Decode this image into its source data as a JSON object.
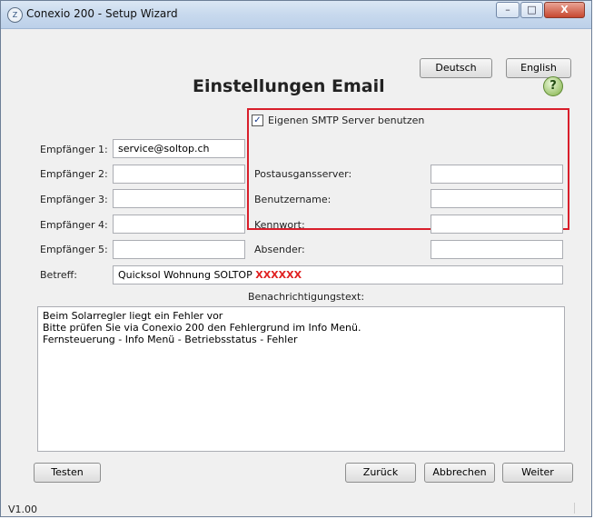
{
  "window": {
    "title": "Conexio 200 - Setup Wizard",
    "controls": {
      "minimize": "–",
      "maximize": "□",
      "close": "X"
    }
  },
  "lang": {
    "german": "Deutsch",
    "english": "English"
  },
  "heading": "Einstellungen Email",
  "help_icon": "?",
  "recipients": [
    {
      "label": "Empfänger 1:",
      "value": "service@soltop.ch"
    },
    {
      "label": "Empfänger 2:",
      "value": ""
    },
    {
      "label": "Empfänger 3:",
      "value": ""
    },
    {
      "label": "Empfänger 4:",
      "value": ""
    },
    {
      "label": "Empfänger 5:",
      "value": ""
    }
  ],
  "smtp": {
    "checkbox_label": "Eigenen SMTP Server benutzen",
    "checked": true,
    "fields": [
      {
        "label": "Postausgansserver:",
        "value": ""
      },
      {
        "label": "Benutzername:",
        "value": ""
      },
      {
        "label": "Kennwort:",
        "value": ""
      },
      {
        "label": "Absender:",
        "value": ""
      }
    ]
  },
  "subject": {
    "label": "Betreff:",
    "value": "Quicksol Wohnung SOLTOP",
    "highlight": "XXXXXX"
  },
  "message": {
    "label": "Benachrichtigungstext:",
    "lines": [
      "Beim Solarregler liegt ein Fehler vor",
      "Bitte prüfen Sie via Conexio 200 den Fehlergrund im Info Menü.",
      "Fernsteuerung - Info Menü - Betriebsstatus - Fehler"
    ]
  },
  "buttons": {
    "test": "Testen",
    "back": "Zurück",
    "cancel": "Abbrechen",
    "next": "Weiter"
  },
  "version": "V1.00",
  "colors": {
    "highlight_border": "#d81e2b",
    "highlight_text": "#e02020"
  }
}
